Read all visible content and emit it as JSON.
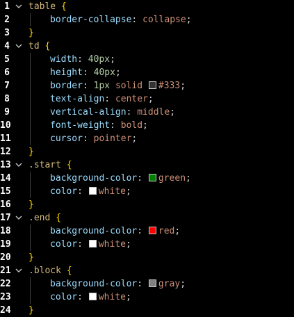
{
  "editor": {
    "lines": [
      {
        "n": "1",
        "fold": true,
        "indent": false,
        "parts": [
          {
            "c": "sel",
            "t": "table"
          },
          {
            "c": "punc",
            "t": " "
          },
          {
            "c": "brace",
            "t": "{"
          }
        ]
      },
      {
        "n": "2",
        "fold": false,
        "indent": true,
        "parts": [
          {
            "c": "prop",
            "t": "border-collapse"
          },
          {
            "c": "punc",
            "t": ": "
          },
          {
            "c": "val",
            "t": "collapse"
          },
          {
            "c": "punc",
            "t": ";"
          }
        ]
      },
      {
        "n": "3",
        "fold": false,
        "indent": false,
        "parts": [
          {
            "c": "brace",
            "t": "}"
          }
        ]
      },
      {
        "n": "4",
        "fold": true,
        "indent": false,
        "parts": [
          {
            "c": "sel",
            "t": "td"
          },
          {
            "c": "punc",
            "t": " "
          },
          {
            "c": "brace",
            "t": "{"
          }
        ]
      },
      {
        "n": "5",
        "fold": false,
        "indent": true,
        "parts": [
          {
            "c": "prop",
            "t": "width"
          },
          {
            "c": "punc",
            "t": ": "
          },
          {
            "c": "num",
            "t": "40px"
          },
          {
            "c": "punc",
            "t": ";"
          }
        ]
      },
      {
        "n": "6",
        "fold": false,
        "indent": true,
        "parts": [
          {
            "c": "prop",
            "t": "height"
          },
          {
            "c": "punc",
            "t": ": "
          },
          {
            "c": "num",
            "t": "40px"
          },
          {
            "c": "punc",
            "t": ";"
          }
        ]
      },
      {
        "n": "7",
        "fold": false,
        "indent": true,
        "parts": [
          {
            "c": "prop",
            "t": "border"
          },
          {
            "c": "punc",
            "t": ": "
          },
          {
            "c": "num",
            "t": "1px"
          },
          {
            "c": "punc",
            "t": " "
          },
          {
            "c": "val",
            "t": "solid"
          },
          {
            "c": "punc",
            "t": " "
          },
          {
            "c": "swatch",
            "color": "#333333"
          },
          {
            "c": "val",
            "t": "#333"
          },
          {
            "c": "punc",
            "t": ";"
          }
        ]
      },
      {
        "n": "8",
        "fold": false,
        "indent": true,
        "parts": [
          {
            "c": "prop",
            "t": "text-align"
          },
          {
            "c": "punc",
            "t": ": "
          },
          {
            "c": "val",
            "t": "center"
          },
          {
            "c": "punc",
            "t": ";"
          }
        ]
      },
      {
        "n": "9",
        "fold": false,
        "indent": true,
        "parts": [
          {
            "c": "prop",
            "t": "vertical-align"
          },
          {
            "c": "punc",
            "t": ": "
          },
          {
            "c": "val",
            "t": "middle"
          },
          {
            "c": "punc",
            "t": ";"
          }
        ]
      },
      {
        "n": "10",
        "fold": false,
        "indent": true,
        "parts": [
          {
            "c": "prop",
            "t": "font-weight"
          },
          {
            "c": "punc",
            "t": ": "
          },
          {
            "c": "val",
            "t": "bold"
          },
          {
            "c": "punc",
            "t": ";"
          }
        ]
      },
      {
        "n": "11",
        "fold": false,
        "indent": true,
        "parts": [
          {
            "c": "prop",
            "t": "cursor"
          },
          {
            "c": "punc",
            "t": ": "
          },
          {
            "c": "val",
            "t": "pointer"
          },
          {
            "c": "punc",
            "t": ";"
          }
        ]
      },
      {
        "n": "12",
        "fold": false,
        "indent": false,
        "parts": [
          {
            "c": "brace",
            "t": "}"
          }
        ]
      },
      {
        "n": "13",
        "fold": true,
        "indent": false,
        "parts": [
          {
            "c": "sel",
            "t": ".start"
          },
          {
            "c": "punc",
            "t": " "
          },
          {
            "c": "brace",
            "t": "{"
          }
        ]
      },
      {
        "n": "14",
        "fold": false,
        "indent": true,
        "parts": [
          {
            "c": "prop",
            "t": "background-color"
          },
          {
            "c": "punc",
            "t": ": "
          },
          {
            "c": "swatch",
            "color": "#008000"
          },
          {
            "c": "val",
            "t": "green"
          },
          {
            "c": "punc",
            "t": ";"
          }
        ]
      },
      {
        "n": "15",
        "fold": false,
        "indent": true,
        "parts": [
          {
            "c": "prop",
            "t": "color"
          },
          {
            "c": "punc",
            "t": ": "
          },
          {
            "c": "swatch",
            "color": "#ffffff"
          },
          {
            "c": "val",
            "t": "white"
          },
          {
            "c": "punc",
            "t": ";"
          }
        ]
      },
      {
        "n": "16",
        "fold": false,
        "indent": false,
        "parts": [
          {
            "c": "brace",
            "t": "}"
          }
        ]
      },
      {
        "n": "17",
        "fold": true,
        "indent": false,
        "parts": [
          {
            "c": "sel",
            "t": ".end"
          },
          {
            "c": "punc",
            "t": " "
          },
          {
            "c": "brace",
            "t": "{"
          }
        ]
      },
      {
        "n": "18",
        "fold": false,
        "indent": true,
        "parts": [
          {
            "c": "prop",
            "t": "background-color"
          },
          {
            "c": "punc",
            "t": ": "
          },
          {
            "c": "swatch",
            "color": "#ff0000"
          },
          {
            "c": "val",
            "t": "red"
          },
          {
            "c": "punc",
            "t": ";"
          }
        ]
      },
      {
        "n": "19",
        "fold": false,
        "indent": true,
        "parts": [
          {
            "c": "prop",
            "t": "color"
          },
          {
            "c": "punc",
            "t": ": "
          },
          {
            "c": "swatch",
            "color": "#ffffff"
          },
          {
            "c": "val",
            "t": "white"
          },
          {
            "c": "punc",
            "t": ";"
          }
        ]
      },
      {
        "n": "20",
        "fold": false,
        "indent": false,
        "parts": [
          {
            "c": "brace",
            "t": "}"
          }
        ]
      },
      {
        "n": "21",
        "fold": true,
        "indent": false,
        "parts": [
          {
            "c": "sel",
            "t": ".block"
          },
          {
            "c": "punc",
            "t": " "
          },
          {
            "c": "brace",
            "t": "{"
          }
        ]
      },
      {
        "n": "22",
        "fold": false,
        "indent": true,
        "parts": [
          {
            "c": "prop",
            "t": "background-color"
          },
          {
            "c": "punc",
            "t": ": "
          },
          {
            "c": "swatch",
            "color": "#808080"
          },
          {
            "c": "val",
            "t": "gray"
          },
          {
            "c": "punc",
            "t": ";"
          }
        ]
      },
      {
        "n": "23",
        "fold": false,
        "indent": true,
        "parts": [
          {
            "c": "prop",
            "t": "color"
          },
          {
            "c": "punc",
            "t": ": "
          },
          {
            "c": "swatch",
            "color": "#ffffff"
          },
          {
            "c": "val",
            "t": "white"
          },
          {
            "c": "punc",
            "t": ";"
          }
        ]
      },
      {
        "n": "24",
        "fold": false,
        "indent": false,
        "parts": [
          {
            "c": "brace",
            "t": "}"
          }
        ]
      }
    ]
  },
  "icons": {
    "fold": "chevron-down-icon",
    "swatch": "color-swatch-icon"
  }
}
